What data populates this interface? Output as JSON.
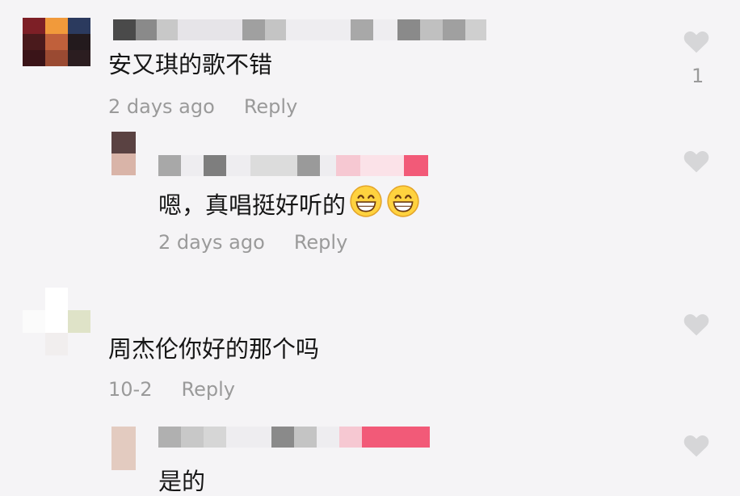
{
  "comments": [
    {
      "text": "安又琪的歌不错",
      "time": "2 days ago",
      "reply_label": "Reply",
      "like_count": "1",
      "replies": [
        {
          "text": "嗯，真唱挺好听的",
          "emoji": [
            "grinning-face-emoji",
            "grinning-face-emoji"
          ],
          "time": "2 days ago",
          "reply_label": "Reply"
        }
      ]
    },
    {
      "text": "周杰伦你好的那个吗",
      "time": "10-2",
      "reply_label": "Reply",
      "replies": [
        {
          "text": "是的"
        }
      ]
    }
  ],
  "icons": {
    "like": "heart-icon"
  },
  "colors": {
    "background": "#f5f4f6",
    "text": "#161616",
    "meta": "#9a9a9a",
    "heart": "#d6d6d8",
    "author_tag": "#f25a78"
  }
}
